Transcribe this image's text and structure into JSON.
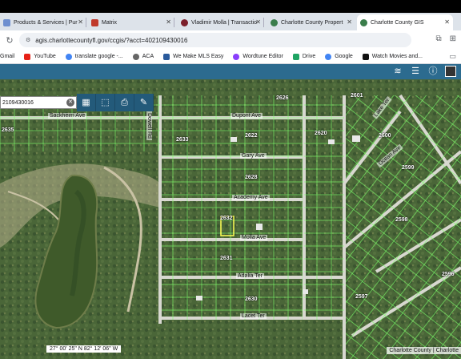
{
  "tabs": [
    {
      "label": "Products & Services | Pur",
      "color": "#6e8fcf"
    },
    {
      "label": "Matrix",
      "color": "#c0392b"
    },
    {
      "label": "Vladimir Molla | Transactio",
      "color": "#7b1f2b"
    },
    {
      "label": "Charlotte County Propert",
      "color": "#3a7d4b"
    },
    {
      "label": "Charlotte County GIS",
      "color": "#3a7d4b"
    }
  ],
  "address": {
    "url": "agis.charlottecountyfl.gov/ccgis/?acct=402109430016"
  },
  "bookmarks": [
    {
      "label": "Gmail",
      "color": "#ffffff"
    },
    {
      "label": "YouTube",
      "color": "#e62117"
    },
    {
      "label": "translate google -...",
      "color": "#4285f4"
    },
    {
      "label": "ACA",
      "color": "#666666"
    },
    {
      "label": "We Make MLS Easy",
      "color": "#2a5a9c"
    },
    {
      "label": "Wordtune Editor",
      "color": "#8a3ffc"
    },
    {
      "label": "Drive",
      "color": "#1fa463"
    },
    {
      "label": "Google",
      "color": "#4285f4"
    },
    {
      "label": "Watch Movies and...",
      "color": "#111111"
    }
  ],
  "search": {
    "value": "2109430016"
  },
  "map": {
    "coordinates": "27° 00' 25\" N 82° 12' 06\" W",
    "attribution": "Charlotte County | Charlotte",
    "streets": [
      "Sackheim Ave",
      "Dupont Ave",
      "Gary Ave",
      "Academy Ave",
      "Molla Ave",
      "Adalia Ter",
      "Lacet Ter",
      "Dowell Rd",
      "Ocean Ave",
      "Lake Ter"
    ],
    "block_numbers": [
      "2635",
      "2626",
      "2601",
      "2633",
      "2622",
      "2620",
      "2600",
      "2628",
      "2599",
      "2598",
      "2632",
      "2631",
      "2630",
      "2597",
      "2596",
      "2628"
    ]
  },
  "colors": {
    "app_header": "#2c6b8f",
    "toolbar": "#235a7a",
    "parcel_line": "#7dff6a",
    "road": "#d8d8d0"
  }
}
